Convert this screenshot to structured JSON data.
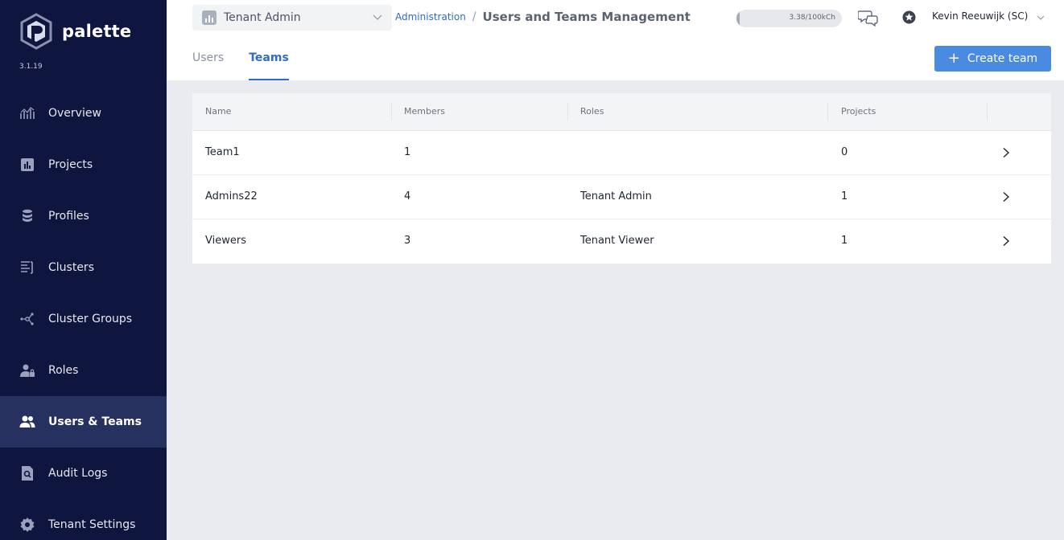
{
  "brand": {
    "name": "palette",
    "version": "3.1.19"
  },
  "sidebar": {
    "items": [
      {
        "label": "Overview",
        "icon": "overview-icon",
        "active": false
      },
      {
        "label": "Projects",
        "icon": "projects-icon",
        "active": false
      },
      {
        "label": "Profiles",
        "icon": "profiles-icon",
        "active": false
      },
      {
        "label": "Clusters",
        "icon": "clusters-icon",
        "active": false
      },
      {
        "label": "Cluster Groups",
        "icon": "cluster-groups-icon",
        "active": false
      },
      {
        "label": "Roles",
        "icon": "roles-icon",
        "active": false
      },
      {
        "label": "Users & Teams",
        "icon": "users-teams-icon",
        "active": true
      },
      {
        "label": "Audit Logs",
        "icon": "audit-logs-icon",
        "active": false
      },
      {
        "label": "Tenant Settings",
        "icon": "gear-icon",
        "active": false
      }
    ]
  },
  "header": {
    "scope_label": "Tenant Admin",
    "breadcrumb_link": "Administration",
    "breadcrumb_sep": "/",
    "page_title": "Users and Teams Management",
    "usage_text": "3.38/100kCh",
    "usage_fraction": 0.0338,
    "user_name": "Kevin Reeuwijk (SC)"
  },
  "tabs": [
    {
      "label": "Users",
      "active": false
    },
    {
      "label": "Teams",
      "active": true
    }
  ],
  "create_button": {
    "label": "Create team",
    "plus": "+"
  },
  "table": {
    "columns": [
      "Name",
      "Members",
      "Roles",
      "Projects"
    ],
    "rows": [
      {
        "name": "Team1",
        "members": "1",
        "roles": "",
        "projects": "0"
      },
      {
        "name": "Admins22",
        "members": "4",
        "roles": "Tenant Admin",
        "projects": "1"
      },
      {
        "name": "Viewers",
        "members": "3",
        "roles": "Tenant Viewer",
        "projects": "1"
      }
    ]
  },
  "colors": {
    "sidebar_bg": "#0e1640",
    "sidebar_active": "#273160",
    "accent": "#2f6cc2",
    "button": "#4a8ae0"
  }
}
